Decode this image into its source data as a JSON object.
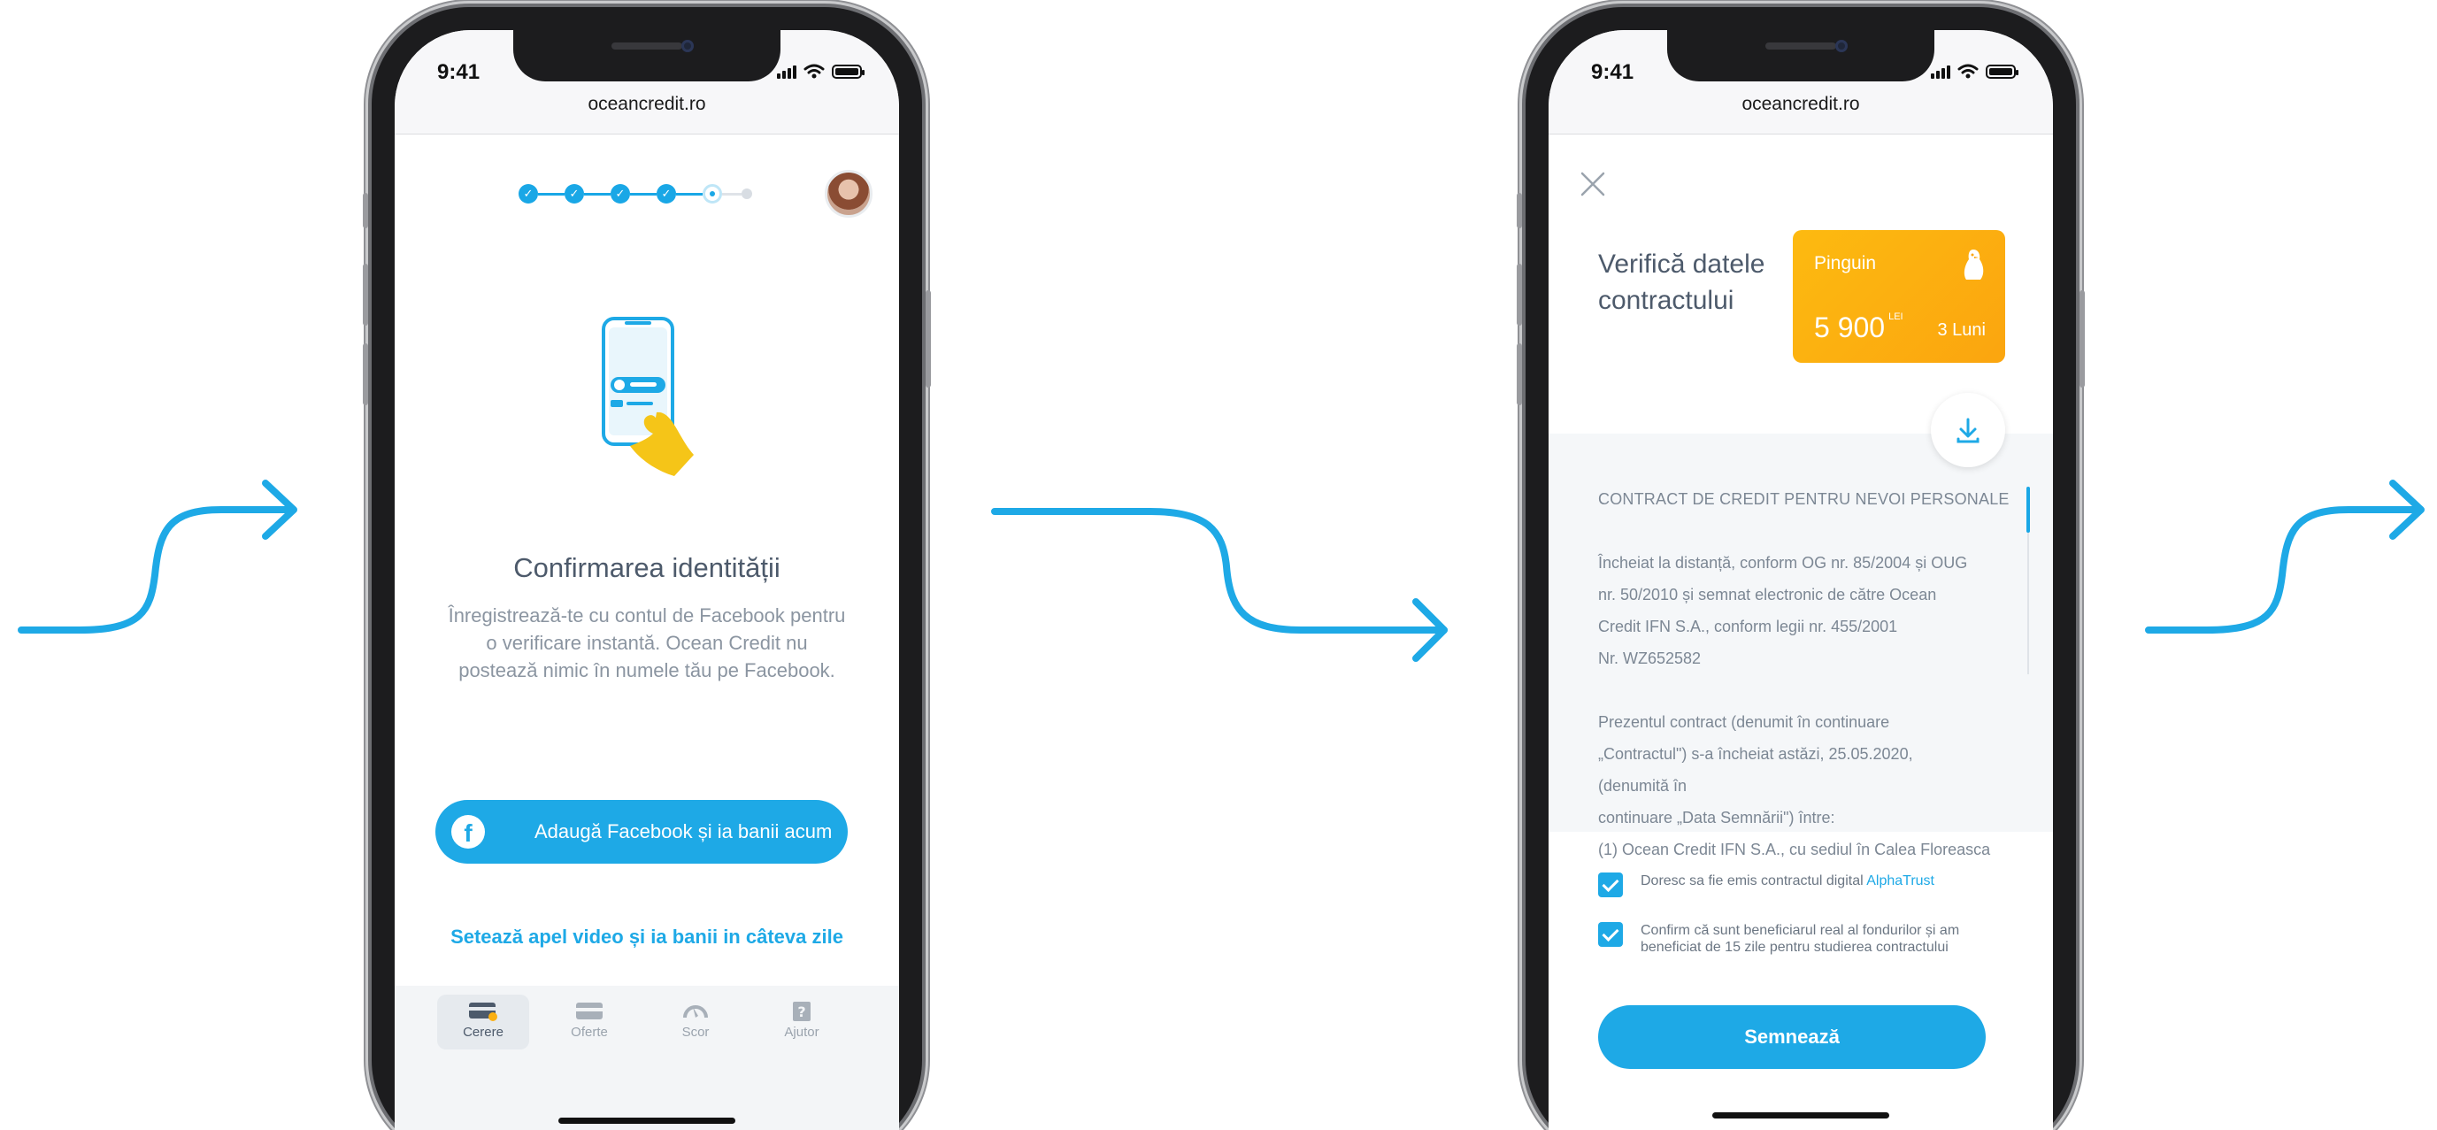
{
  "colors": {
    "accent": "#1ea9e6",
    "card": "#fdb112",
    "title": "#4d5a6b",
    "muted": "#8b95a1"
  },
  "status": {
    "time": "9:41"
  },
  "browser": {
    "url": "oceancredit.ro"
  },
  "identity_screen": {
    "stepper": {
      "completed_steps": 4,
      "current_step": 5,
      "total_steps": 6
    },
    "title": "Confirmarea identității",
    "description": "Înregistrează-te cu contul de Facebook pentru o verificare instantă. Ocean Credit nu postează nimic în numele tău pe Facebook.",
    "facebook_button": "Adaugă Facebook și ia banii acum",
    "video_link": "Setează apel video și ia banii in câteva zile",
    "tabs": [
      {
        "label": "Cerere",
        "icon": "request-card-icon",
        "active": true
      },
      {
        "label": "Oferte",
        "icon": "offers-card-icon",
        "active": false
      },
      {
        "label": "Scor",
        "icon": "score-gauge-icon",
        "active": false
      },
      {
        "label": "Ajutor",
        "icon": "help-question-icon",
        "active": false
      }
    ]
  },
  "contract_screen": {
    "title": "Verifică datele contractului",
    "offer": {
      "name": "Pinguin",
      "amount": "5 900",
      "currency": "LEI",
      "term": "3 Luni",
      "icon": "penguin-icon"
    },
    "contract_heading": "CONTRACT DE CREDIT PENTRU NEVOI PERSONALE",
    "paragraph_1": [
      "Încheiat la distanță, conform OG nr. 85/2004 și OUG",
      "nr. 50/2010 și semnat electronic de către Ocean",
      "Credit IFN S.A., conform legii nr. 455/2001",
      "Nr. WZ652582"
    ],
    "paragraph_2": [
      "Prezentul contract (denumit în continuare",
      "„Contractul\") s-a încheiat astăzi, 25.05.2020,",
      "(denumită în",
      "continuare „Data Semnării\") între:",
      "(1) Ocean Credit IFN S.A., cu sediul în Calea Floreasca"
    ],
    "checkbox_1": {
      "text": "Doresc sa fie emis contractul digital ",
      "link": "AlphaTrust",
      "checked": true
    },
    "checkbox_2": {
      "text": "Confirm că sunt beneficiarul real al fondurilor și am beneficiat de 15 zile pentru studierea contractului",
      "checked": true
    },
    "sign_button": "Semnează"
  }
}
